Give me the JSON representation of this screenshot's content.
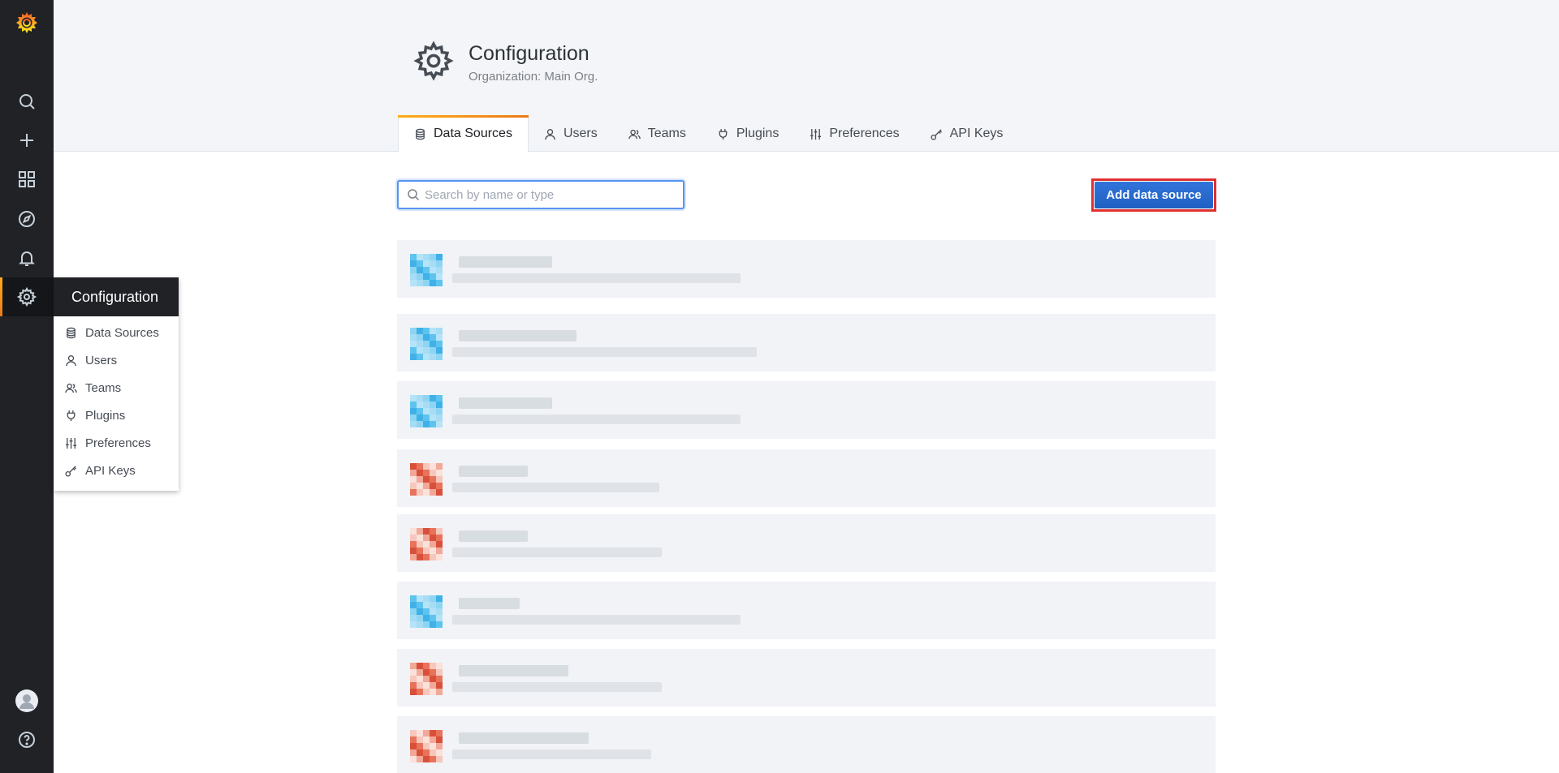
{
  "sidebar": {
    "items": [
      {
        "name": "search-icon"
      },
      {
        "name": "plus-icon"
      },
      {
        "name": "dashboards-icon"
      },
      {
        "name": "explore-icon"
      },
      {
        "name": "bell-icon"
      },
      {
        "name": "gear-icon"
      }
    ],
    "active": "gear-icon",
    "bottom": [
      {
        "name": "avatar"
      },
      {
        "name": "help-icon"
      }
    ]
  },
  "config_menu": {
    "title": "Configuration",
    "items": [
      {
        "label": "Data Sources",
        "icon": "database-icon"
      },
      {
        "label": "Users",
        "icon": "user-icon"
      },
      {
        "label": "Teams",
        "icon": "users-icon"
      },
      {
        "label": "Plugins",
        "icon": "plug-icon"
      },
      {
        "label": "Preferences",
        "icon": "sliders-icon"
      },
      {
        "label": "API Keys",
        "icon": "key-icon"
      }
    ]
  },
  "header": {
    "title": "Configuration",
    "subtitle": "Organization: Main Org."
  },
  "tabs": [
    {
      "label": "Data Sources",
      "icon": "database-icon",
      "active": true
    },
    {
      "label": "Users",
      "icon": "user-icon",
      "active": false
    },
    {
      "label": "Teams",
      "icon": "users-icon",
      "active": false
    },
    {
      "label": "Plugins",
      "icon": "plug-icon",
      "active": false
    },
    {
      "label": "Preferences",
      "icon": "sliders-icon",
      "active": false
    },
    {
      "label": "API Keys",
      "icon": "key-icon",
      "active": false
    }
  ],
  "search": {
    "placeholder": "Search by name or type",
    "value": ""
  },
  "actions": {
    "add_label": "Add data source"
  },
  "datasources": [
    {
      "kind": "blue",
      "name": "",
      "detail": ""
    },
    {
      "kind": "blue",
      "name": "",
      "detail": ""
    },
    {
      "kind": "blue",
      "name": "",
      "detail": ""
    },
    {
      "kind": "red",
      "name": "",
      "detail": ""
    },
    {
      "kind": "red",
      "name": "",
      "detail": ""
    },
    {
      "kind": "blue",
      "name": "",
      "detail": ""
    },
    {
      "kind": "red",
      "name": "",
      "detail": ""
    },
    {
      "kind": "red",
      "name": "",
      "detail": ""
    }
  ],
  "colors": {
    "sidebar_bg": "#202226",
    "accent_orange": "#eb7b18",
    "primary_blue": "#3274d9",
    "highlight_red": "#e02f2f",
    "ds_blue": "#5ec4ef",
    "ds_red": "#e8735a"
  }
}
